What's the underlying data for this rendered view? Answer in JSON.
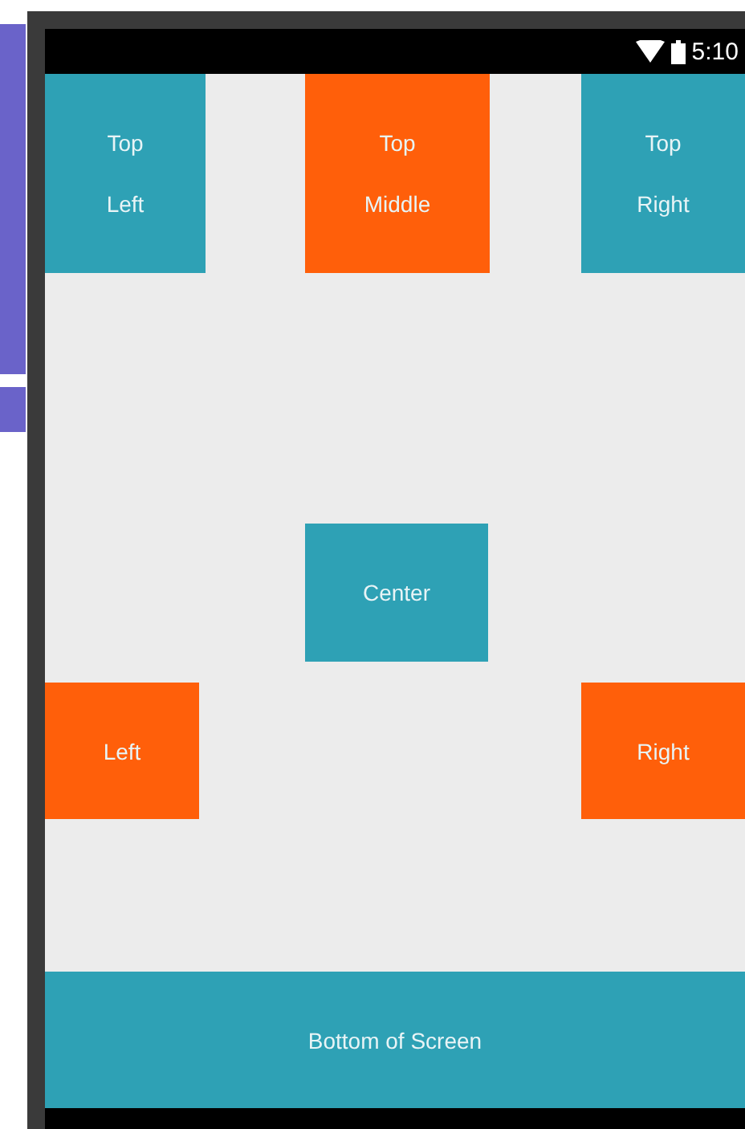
{
  "status_bar": {
    "time": "5:10"
  },
  "boxes": [
    {
      "kind": "top-left",
      "lines": [
        "Top",
        "Left"
      ],
      "color": "#2ea1b5"
    },
    {
      "kind": "top-middle",
      "lines": [
        "Top",
        "Middle"
      ],
      "color": "#ff5f0a"
    },
    {
      "kind": "top-right",
      "lines": [
        "Top",
        "Right"
      ],
      "color": "#2ea1b5"
    },
    {
      "kind": "center",
      "lines": [
        "Center"
      ],
      "color": "#2ea1b5"
    },
    {
      "kind": "left",
      "lines": [
        "Left"
      ],
      "color": "#ff5f0a"
    },
    {
      "kind": "right",
      "lines": [
        "Right"
      ],
      "color": "#ff5f0a"
    },
    {
      "kind": "bottom",
      "lines": [
        "Bottom of Screen"
      ],
      "color": "#2ea1b5"
    }
  ]
}
